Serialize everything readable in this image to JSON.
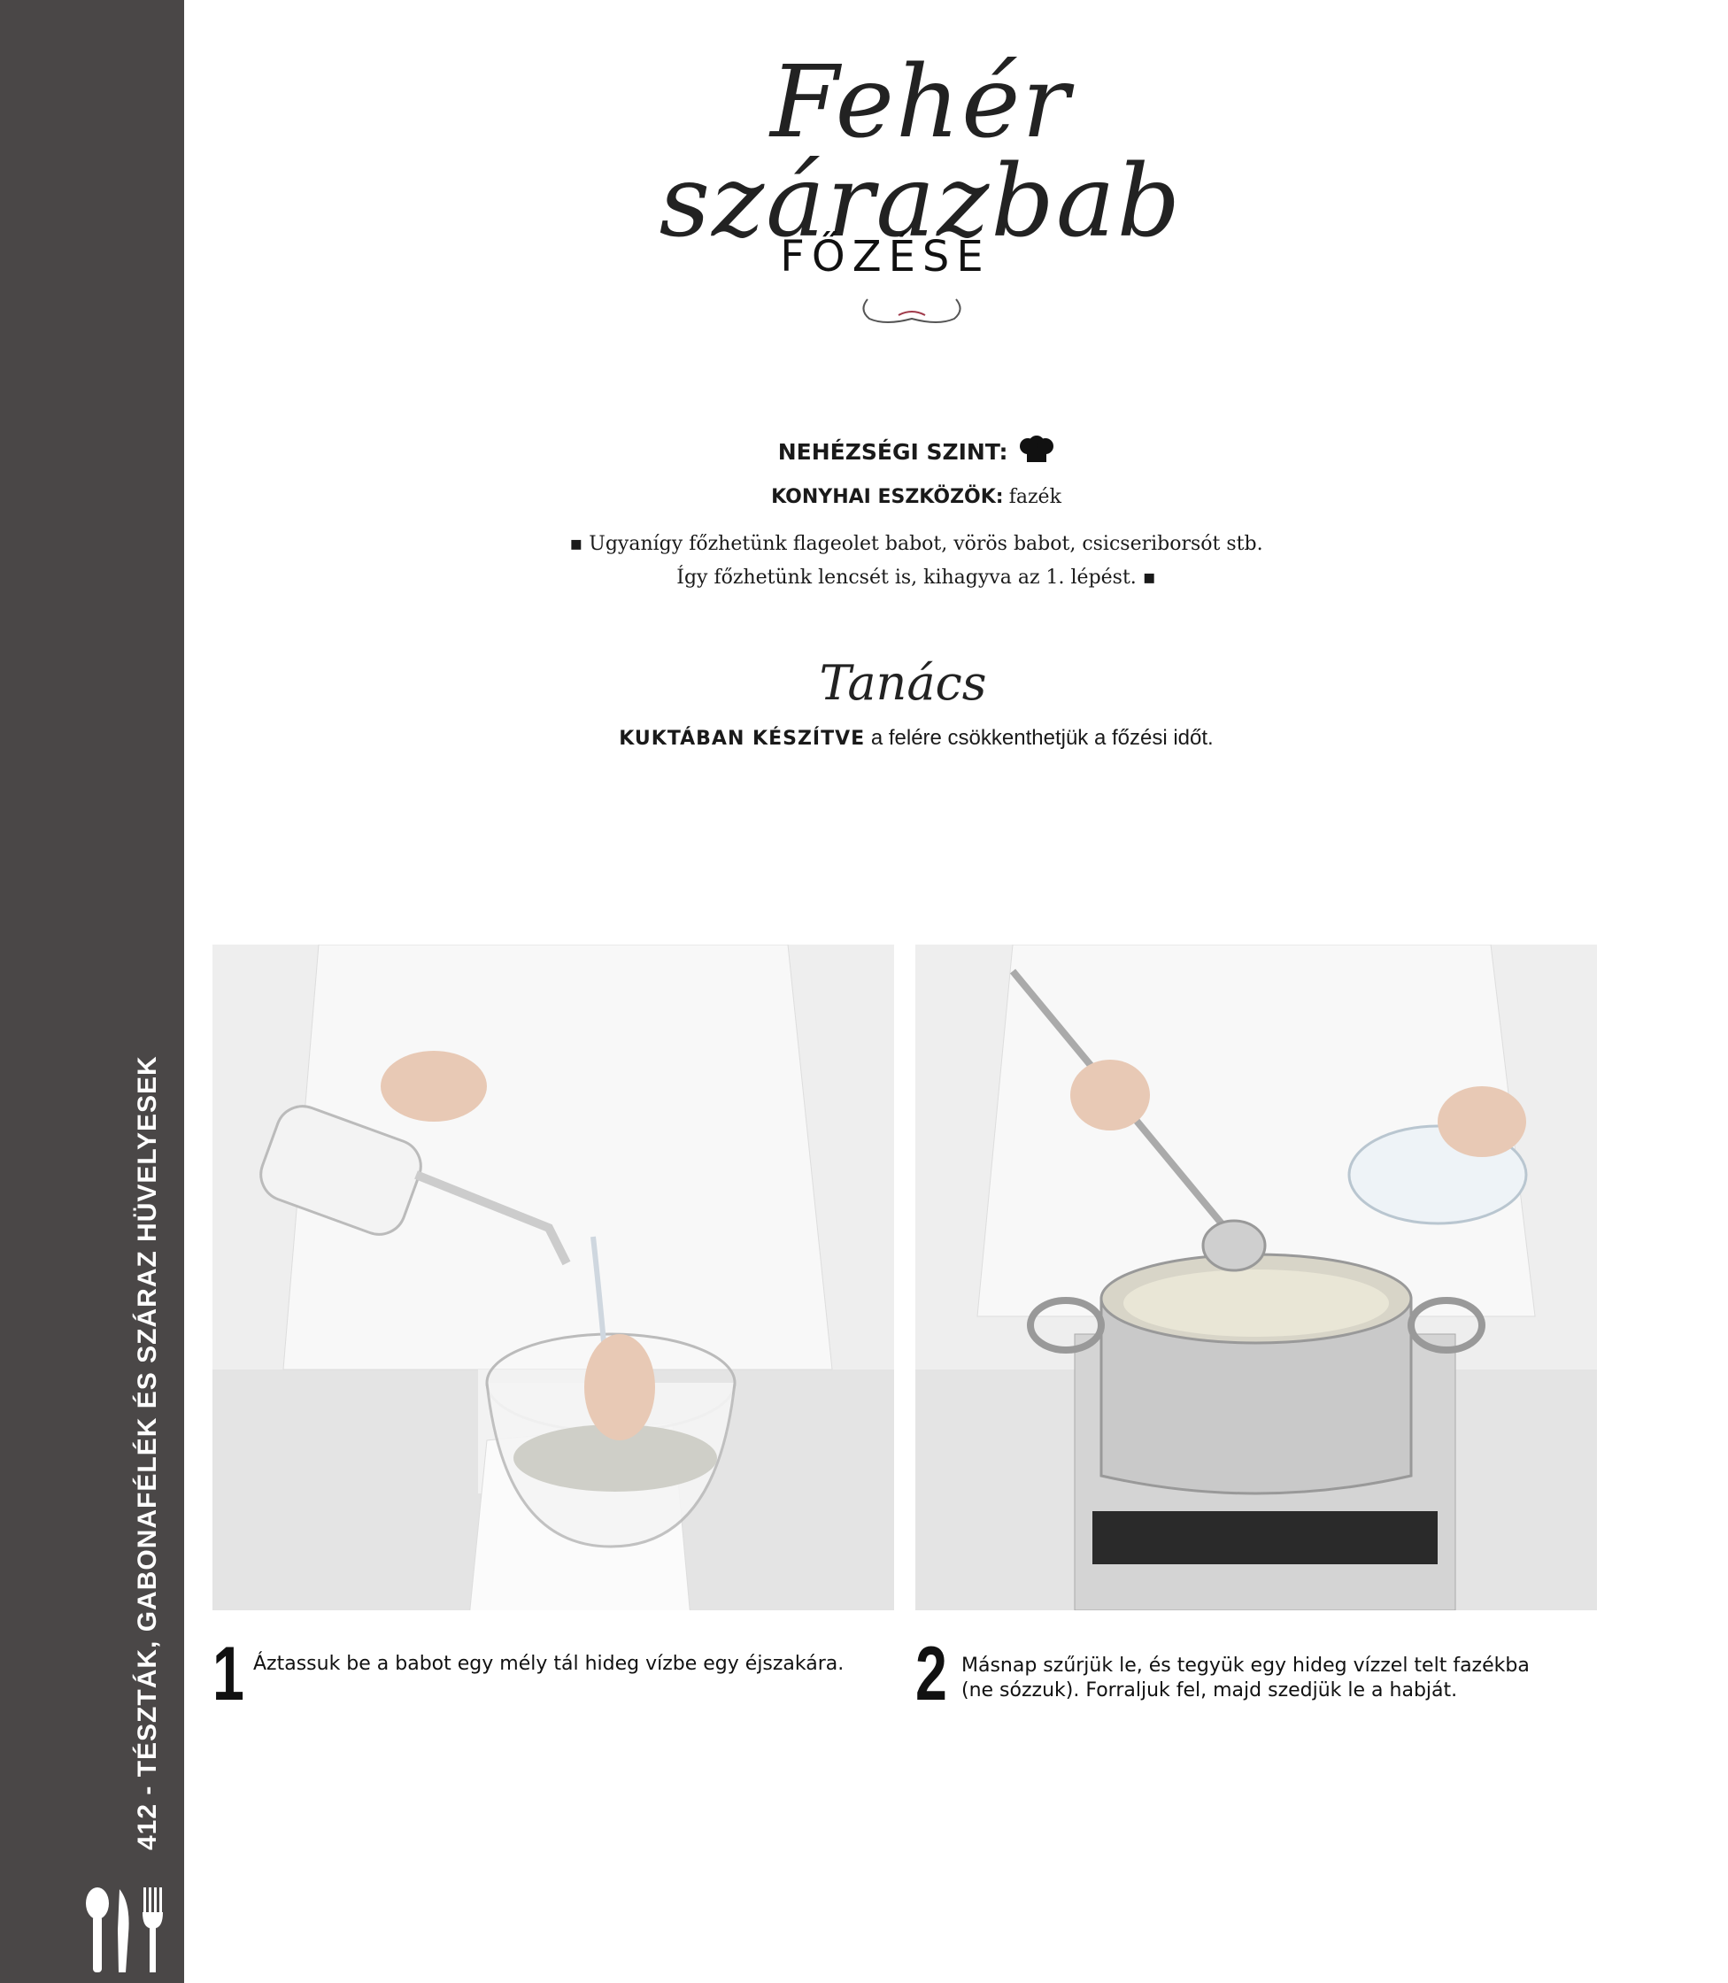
{
  "sidebar": {
    "page_label": "412 - TÉSZTÁK, GABONAFÉLÉK ÉS SZÁRAZ HÜVELYESEK",
    "icon": "cutlery-icon"
  },
  "title": {
    "script": "Fehér szárazbab",
    "sub": "FŐZÉSE"
  },
  "info": {
    "difficulty_label": "NEHÉZSÉGI SZINT:",
    "difficulty_icon": "chef-hat-icon",
    "tools_label": "KONYHAI ESZKÖZÖK:",
    "tools_value": "fazék",
    "note_line1": "▪ Ugyanígy főzhetünk flageolet babot, vörös babot, csicseriborsót stb.",
    "note_line2": "Így főzhetünk lencsét is, kihagyva az 1. lépést. ▪"
  },
  "tip": {
    "heading": "Tanács",
    "bold": "KUKTÁBAN KÉSZÍTVE",
    "text": " a felére csökkenthetjük a főzési időt."
  },
  "steps": [
    {
      "number": "1",
      "text": "Áztassuk be a babot egy mély tál hideg vízbe egy éjszakára."
    },
    {
      "number": "2",
      "text_line1": "Másnap szűrjük le, és tegyük egy hideg vízzel telt fazékba",
      "text_line2": "(ne sózzuk). Forraljuk fel, majd szedjük le a habját."
    }
  ]
}
